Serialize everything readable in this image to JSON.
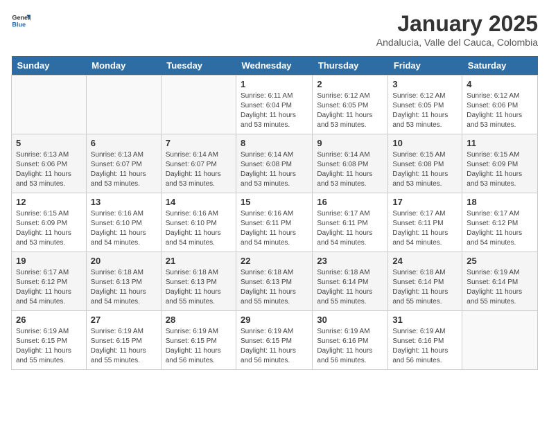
{
  "logo": {
    "text_general": "General",
    "text_blue": "Blue"
  },
  "header": {
    "month": "January 2025",
    "location": "Andalucia, Valle del Cauca, Colombia"
  },
  "weekdays": [
    "Sunday",
    "Monday",
    "Tuesday",
    "Wednesday",
    "Thursday",
    "Friday",
    "Saturday"
  ],
  "weeks": [
    [
      {
        "day": "",
        "info": ""
      },
      {
        "day": "",
        "info": ""
      },
      {
        "day": "",
        "info": ""
      },
      {
        "day": "1",
        "info": "Sunrise: 6:11 AM\nSunset: 6:04 PM\nDaylight: 11 hours and 53 minutes."
      },
      {
        "day": "2",
        "info": "Sunrise: 6:12 AM\nSunset: 6:05 PM\nDaylight: 11 hours and 53 minutes."
      },
      {
        "day": "3",
        "info": "Sunrise: 6:12 AM\nSunset: 6:05 PM\nDaylight: 11 hours and 53 minutes."
      },
      {
        "day": "4",
        "info": "Sunrise: 6:12 AM\nSunset: 6:06 PM\nDaylight: 11 hours and 53 minutes."
      }
    ],
    [
      {
        "day": "5",
        "info": "Sunrise: 6:13 AM\nSunset: 6:06 PM\nDaylight: 11 hours and 53 minutes."
      },
      {
        "day": "6",
        "info": "Sunrise: 6:13 AM\nSunset: 6:07 PM\nDaylight: 11 hours and 53 minutes."
      },
      {
        "day": "7",
        "info": "Sunrise: 6:14 AM\nSunset: 6:07 PM\nDaylight: 11 hours and 53 minutes."
      },
      {
        "day": "8",
        "info": "Sunrise: 6:14 AM\nSunset: 6:08 PM\nDaylight: 11 hours and 53 minutes."
      },
      {
        "day": "9",
        "info": "Sunrise: 6:14 AM\nSunset: 6:08 PM\nDaylight: 11 hours and 53 minutes."
      },
      {
        "day": "10",
        "info": "Sunrise: 6:15 AM\nSunset: 6:08 PM\nDaylight: 11 hours and 53 minutes."
      },
      {
        "day": "11",
        "info": "Sunrise: 6:15 AM\nSunset: 6:09 PM\nDaylight: 11 hours and 53 minutes."
      }
    ],
    [
      {
        "day": "12",
        "info": "Sunrise: 6:15 AM\nSunset: 6:09 PM\nDaylight: 11 hours and 53 minutes."
      },
      {
        "day": "13",
        "info": "Sunrise: 6:16 AM\nSunset: 6:10 PM\nDaylight: 11 hours and 54 minutes."
      },
      {
        "day": "14",
        "info": "Sunrise: 6:16 AM\nSunset: 6:10 PM\nDaylight: 11 hours and 54 minutes."
      },
      {
        "day": "15",
        "info": "Sunrise: 6:16 AM\nSunset: 6:11 PM\nDaylight: 11 hours and 54 minutes."
      },
      {
        "day": "16",
        "info": "Sunrise: 6:17 AM\nSunset: 6:11 PM\nDaylight: 11 hours and 54 minutes."
      },
      {
        "day": "17",
        "info": "Sunrise: 6:17 AM\nSunset: 6:11 PM\nDaylight: 11 hours and 54 minutes."
      },
      {
        "day": "18",
        "info": "Sunrise: 6:17 AM\nSunset: 6:12 PM\nDaylight: 11 hours and 54 minutes."
      }
    ],
    [
      {
        "day": "19",
        "info": "Sunrise: 6:17 AM\nSunset: 6:12 PM\nDaylight: 11 hours and 54 minutes."
      },
      {
        "day": "20",
        "info": "Sunrise: 6:18 AM\nSunset: 6:13 PM\nDaylight: 11 hours and 54 minutes."
      },
      {
        "day": "21",
        "info": "Sunrise: 6:18 AM\nSunset: 6:13 PM\nDaylight: 11 hours and 55 minutes."
      },
      {
        "day": "22",
        "info": "Sunrise: 6:18 AM\nSunset: 6:13 PM\nDaylight: 11 hours and 55 minutes."
      },
      {
        "day": "23",
        "info": "Sunrise: 6:18 AM\nSunset: 6:14 PM\nDaylight: 11 hours and 55 minutes."
      },
      {
        "day": "24",
        "info": "Sunrise: 6:18 AM\nSunset: 6:14 PM\nDaylight: 11 hours and 55 minutes."
      },
      {
        "day": "25",
        "info": "Sunrise: 6:19 AM\nSunset: 6:14 PM\nDaylight: 11 hours and 55 minutes."
      }
    ],
    [
      {
        "day": "26",
        "info": "Sunrise: 6:19 AM\nSunset: 6:15 PM\nDaylight: 11 hours and 55 minutes."
      },
      {
        "day": "27",
        "info": "Sunrise: 6:19 AM\nSunset: 6:15 PM\nDaylight: 11 hours and 55 minutes."
      },
      {
        "day": "28",
        "info": "Sunrise: 6:19 AM\nSunset: 6:15 PM\nDaylight: 11 hours and 56 minutes."
      },
      {
        "day": "29",
        "info": "Sunrise: 6:19 AM\nSunset: 6:15 PM\nDaylight: 11 hours and 56 minutes."
      },
      {
        "day": "30",
        "info": "Sunrise: 6:19 AM\nSunset: 6:16 PM\nDaylight: 11 hours and 56 minutes."
      },
      {
        "day": "31",
        "info": "Sunrise: 6:19 AM\nSunset: 6:16 PM\nDaylight: 11 hours and 56 minutes."
      },
      {
        "day": "",
        "info": ""
      }
    ]
  ]
}
